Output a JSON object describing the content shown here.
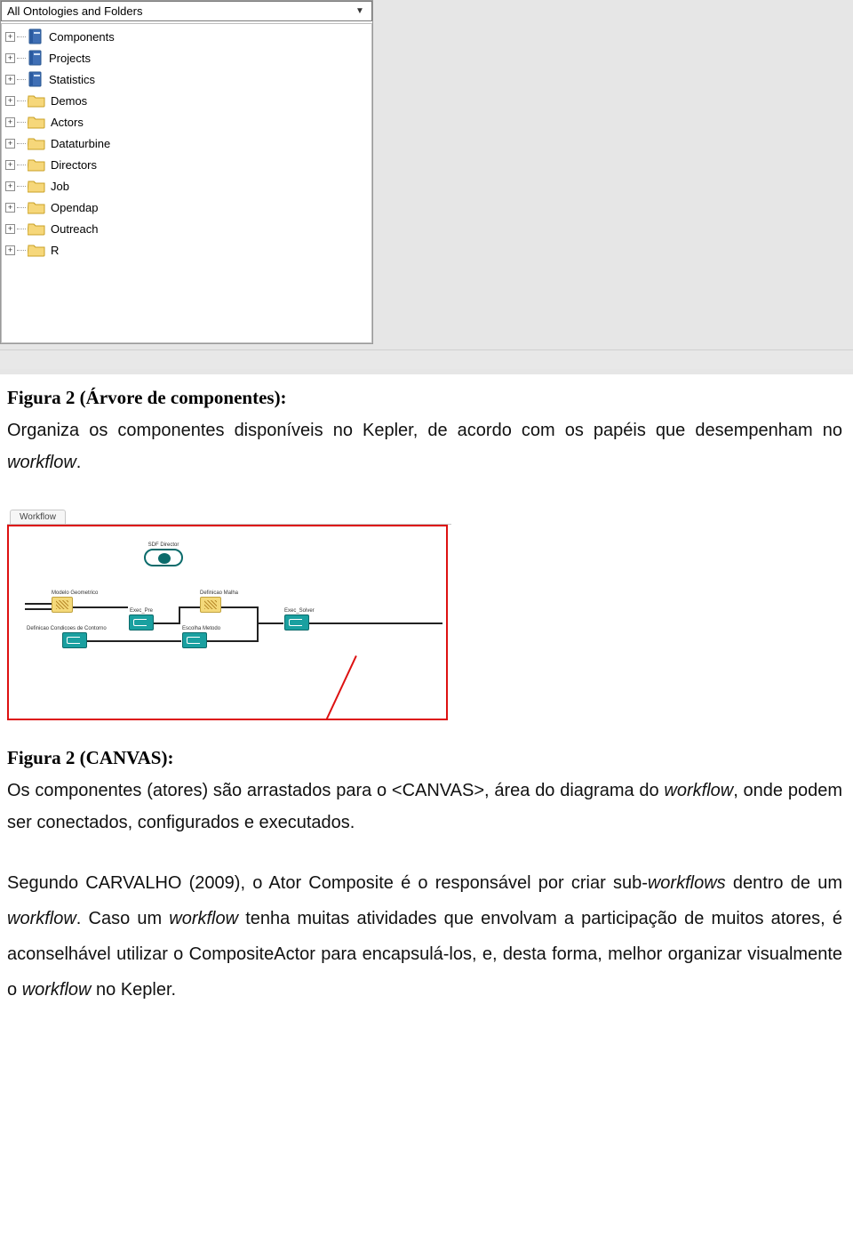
{
  "treePanel": {
    "dropdown": "All Ontologies and Folders",
    "items": [
      {
        "label": "Components",
        "iconType": "book"
      },
      {
        "label": "Projects",
        "iconType": "book"
      },
      {
        "label": "Statistics",
        "iconType": "book"
      },
      {
        "label": "Demos",
        "iconType": "folder"
      },
      {
        "label": "Actors",
        "iconType": "folder"
      },
      {
        "label": "Dataturbine",
        "iconType": "folder"
      },
      {
        "label": "Directors",
        "iconType": "folder"
      },
      {
        "label": "Job",
        "iconType": "folder"
      },
      {
        "label": "Opendap",
        "iconType": "folder"
      },
      {
        "label": "Outreach",
        "iconType": "folder"
      },
      {
        "label": "R",
        "iconType": "folder"
      }
    ]
  },
  "fig1": {
    "caption": "Figura 2 (Árvore de componentes):",
    "text_a": "Organiza os componentes disponíveis no Kepler, de acordo com os papéis que desempenham no ",
    "text_b_italic": "workflow",
    "text_c": "."
  },
  "canvas": {
    "tab": "Workflow",
    "director": "SDF Director",
    "nodes": {
      "modelo": "Modelo Geometrico",
      "exec_pre": "Exec_Pre",
      "def_malha": "Definicao Malha",
      "def_contorno": "Definicao Condicoes de Contorno",
      "escolha": "Escolha Metodo",
      "exec_solver": "Exec_Solver"
    }
  },
  "fig2": {
    "caption": "Figura 2 (CANVAS):",
    "text_a": "Os componentes (atores) são arrastados para o <CANVAS>, área do diagrama do ",
    "text_b_italic": "workflow",
    "text_c": ", onde podem ser conectados, configurados e executados."
  },
  "body": {
    "p1_a": "Segundo CARVALHO (2009), o Ator Composite é o responsável por criar sub-",
    "p1_b_italic": "workflows",
    "p1_c": " dentro de um ",
    "p1_d_italic": "workflow",
    "p1_e": ". Caso um ",
    "p1_f_italic": "workflow",
    "p1_g": " tenha muitas atividades que envolvam a participação de muitos atores, é aconselhável utilizar o CompositeActor para encapsulá-los, e, desta forma, melhor organizar visualmente o ",
    "p1_h_italic": "workflow",
    "p1_i": " no Kepler."
  }
}
